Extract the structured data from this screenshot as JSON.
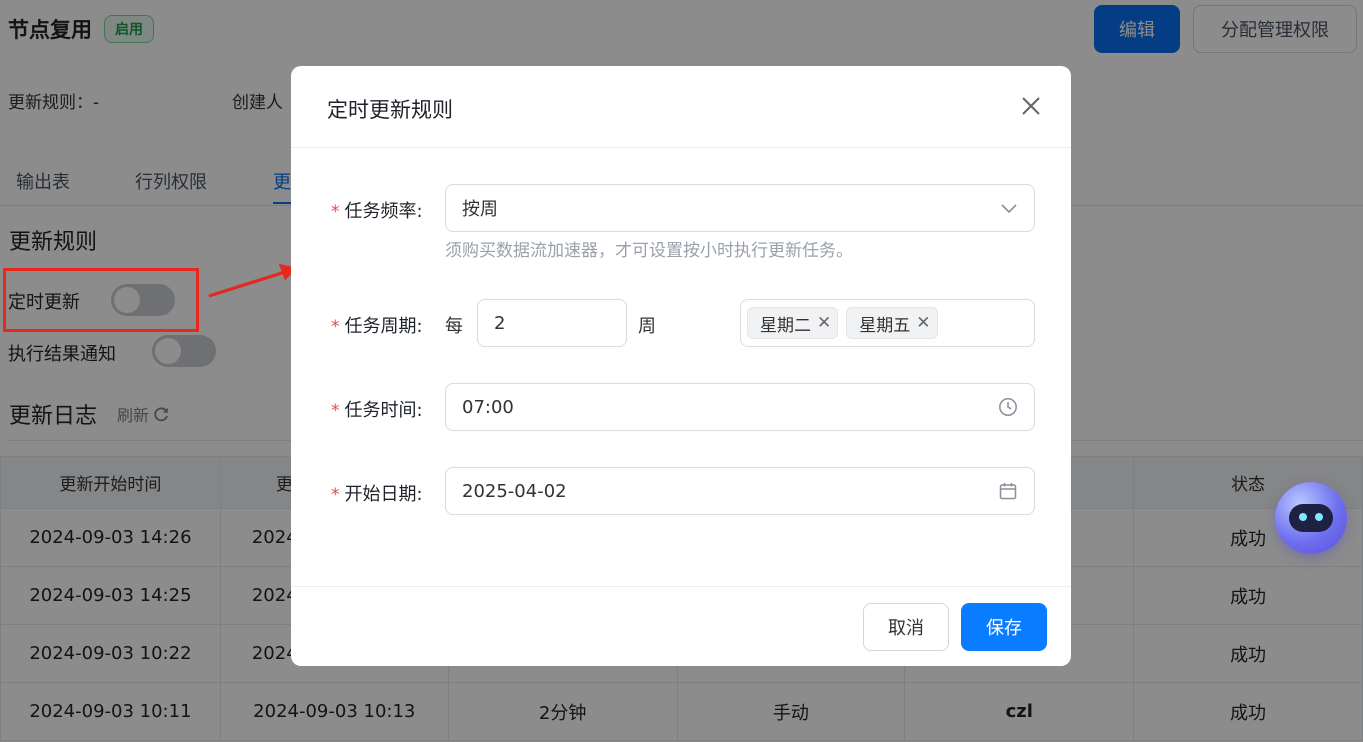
{
  "header": {
    "title": "节点复用",
    "status_badge": "启用",
    "edit_button": "编辑",
    "assign_button": "分配管理权限",
    "update_rule_meta": "更新规则：-",
    "creator_meta": "创建人"
  },
  "tabs": [
    {
      "label": "输出表"
    },
    {
      "label": "行列权限"
    },
    {
      "label": "更"
    }
  ],
  "rules_section": {
    "title": "更新规则",
    "scheduled_update_label": "定时更新",
    "scheduled_update_on": false,
    "notify_label": "执行结果通知",
    "notify_on": false
  },
  "log_section": {
    "title": "更新日志",
    "refresh_label": "刷新"
  },
  "log_table": {
    "columns": [
      "更新开始时间",
      "更",
      "",
      "",
      "",
      "状态"
    ],
    "rows": [
      [
        "2024-09-03 14:26",
        "2024",
        "",
        "",
        "",
        "成功"
      ],
      [
        "2024-09-03 14:25",
        "2024",
        "",
        "",
        "",
        "成功"
      ],
      [
        "2024-09-03 10:22",
        "2024",
        "",
        "",
        "",
        "成功"
      ],
      [
        "2024-09-03 10:11",
        "2024-09-03 10:13",
        "2分钟",
        "手动",
        "czl",
        "成功"
      ]
    ]
  },
  "modal": {
    "title": "定时更新规则",
    "frequency": {
      "label": "任务频率:",
      "value": "按周",
      "hint": "须购买数据流加速器，才可设置按小时执行更新任务。"
    },
    "period": {
      "label": "任务周期:",
      "prefix": "每",
      "value": "2",
      "unit": "周",
      "days": [
        "星期二",
        "星期五"
      ],
      "tag_close": "✕"
    },
    "time": {
      "label": "任务时间:",
      "value": "07:00"
    },
    "start_date": {
      "label": "开始日期:",
      "value": "2025-04-02"
    },
    "required_mark": "*",
    "cancel_button": "取消",
    "save_button": "保存"
  },
  "colors": {
    "primary": "#0a6ff0",
    "required": "#e5484d",
    "annotation": "#e8281c",
    "success_badge": "#1a9c4a"
  }
}
